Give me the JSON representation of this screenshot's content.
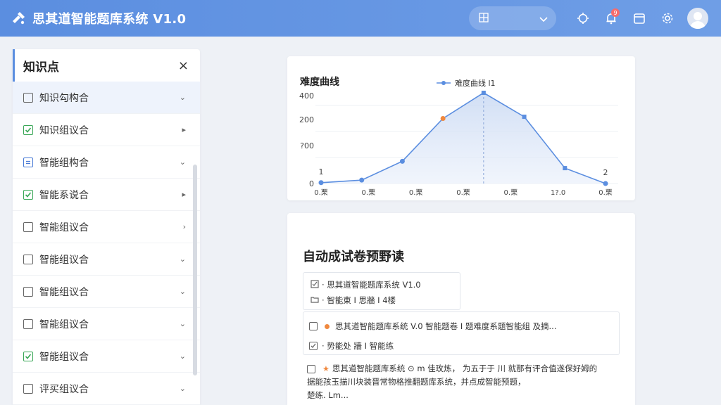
{
  "header": {
    "title": "思其道智能题库系统 V1.0",
    "icons": [
      "logo-icon",
      "layout-icon",
      "chevron-down-icon",
      "target-icon",
      "bell-icon",
      "calendar-icon",
      "gear-icon",
      "avatar"
    ],
    "badge_count": "9"
  },
  "sidebar": {
    "title": "知识点",
    "close": "×",
    "items": [
      {
        "label": "知识勾构合",
        "state": "unchecked",
        "arrow": "⌄"
      },
      {
        "label": "知识组议合",
        "state": "checked",
        "arrow": "▸"
      },
      {
        "label": "智能组构合",
        "state": "partial",
        "arrow": "⌄"
      },
      {
        "label": "智能系说合",
        "state": "checked",
        "arrow": "▸"
      },
      {
        "label": "智能组议合",
        "state": "unchecked",
        "arrow": "›"
      },
      {
        "label": "智能组议合",
        "state": "unchecked",
        "arrow": "⌄"
      },
      {
        "label": "智能组议合",
        "state": "unchecked",
        "arrow": "⌄"
      },
      {
        "label": "智能组议合",
        "state": "unchecked",
        "arrow": "⌄"
      },
      {
        "label": "智能组议合",
        "state": "checked",
        "arrow": "⌄"
      },
      {
        "label": "评买组议合",
        "state": "unchecked",
        "arrow": "⌄"
      }
    ]
  },
  "chart_data": {
    "type": "area",
    "title": "难度曲线",
    "legend": "难度曲线 l1",
    "legend_position": "top",
    "y_ticks": [
      "0",
      "?00",
      "200",
      "400"
    ],
    "x_ticks": [
      "0.栗",
      "0.栗",
      "0.栗",
      "0.栗",
      "0.栗",
      "1?.0",
      "0.栗"
    ],
    "values": [
      5,
      20,
      130,
      380,
      530,
      390,
      90,
      0
    ],
    "highlight_index": 3,
    "point_labels": {
      "first": "1",
      "last": "2"
    },
    "ylim": [
      0,
      530
    ],
    "color": "#5b8ee0"
  },
  "paper": {
    "title": "自动成试卷预野读",
    "box1": {
      "row1": "· 思其道智能题库系统 V1.0",
      "row2": "· 智能東 I 思牆 I 4楼"
    },
    "box2": {
      "row1": "思其道智能题库系统 V.0 智能题卷 I 题难度系题智能组 及摘...",
      "row2": "· 势能处 牆 I 智能练"
    },
    "item3": {
      "line1": "思其道智能题库系统 ⊙ m 佳玫炼，  为五于于 川 就那有评合值遂保好姆的",
      "line2": "据能孩玉描川块装晋常物格推翻题库系统，并点成智能预题，",
      "line3": "楚练. Lm..."
    }
  }
}
